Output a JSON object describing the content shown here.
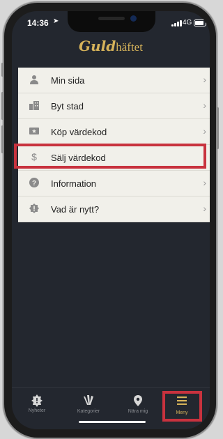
{
  "status": {
    "time": "14:36",
    "network": "4G",
    "location_icon": "location-arrow-icon"
  },
  "header": {
    "logo_script": "Guld",
    "logo_plain": "häftet"
  },
  "menu": {
    "items": [
      {
        "label": "Min sida",
        "icon": "person-icon"
      },
      {
        "label": "Byt stad",
        "icon": "city-icon"
      },
      {
        "label": "Köp värdekod",
        "icon": "ticket-icon"
      },
      {
        "label": "Sälj värdekod",
        "icon": "dollar-icon"
      },
      {
        "label": "Information",
        "icon": "question-icon"
      },
      {
        "label": "Vad är nytt?",
        "icon": "alert-icon"
      }
    ],
    "chevron": "›"
  },
  "tabbar": {
    "tabs": [
      {
        "label": "Nyheter",
        "icon": "news-badge-icon"
      },
      {
        "label": "Kategorier",
        "icon": "categories-icon"
      },
      {
        "label": "Nära mig",
        "icon": "map-pin-icon"
      },
      {
        "label": "Meny",
        "icon": "hamburger-icon"
      }
    ],
    "active_index": 3
  },
  "colors": {
    "background": "#23272f",
    "menu_background": "#f1f0ea",
    "accent_gold": "#d6b35a",
    "highlight_red": "#c8323e"
  }
}
